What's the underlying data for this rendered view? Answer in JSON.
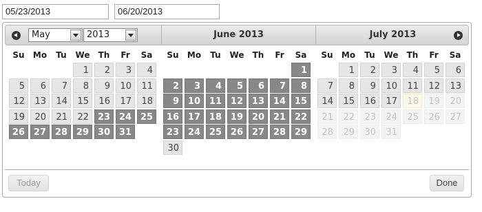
{
  "inputs": {
    "start": "05/23/2013",
    "end": "06/20/2013"
  },
  "header": {
    "month_select": "May",
    "year_select": "2013",
    "titles": [
      "June 2013",
      "July 2013"
    ],
    "prev_icon": "circle-triangle-w-icon",
    "next_icon": "circle-triangle-e-icon"
  },
  "weekdays": [
    "Su",
    "Mo",
    "Tu",
    "We",
    "Th",
    "Fr",
    "Sa"
  ],
  "months": [
    {
      "name": "May 2013",
      "offset": 3,
      "days": 31,
      "range": [
        23,
        31
      ],
      "faded": [],
      "today": null
    },
    {
      "name": "June 2013",
      "offset": 6,
      "days": 30,
      "range": [
        1,
        29
      ],
      "faded": [],
      "today": null
    },
    {
      "name": "July 2013",
      "offset": 1,
      "days": 31,
      "range": null,
      "faded": [
        19,
        20,
        21,
        22,
        23,
        24,
        25,
        26,
        27,
        28,
        29,
        30,
        31
      ],
      "today": 18
    }
  ],
  "buttons": {
    "today": "Today",
    "done": "Done"
  },
  "colors": {
    "range": "#888888",
    "day": "#e6e6e6",
    "today_highlight": "#fbf9ee"
  }
}
